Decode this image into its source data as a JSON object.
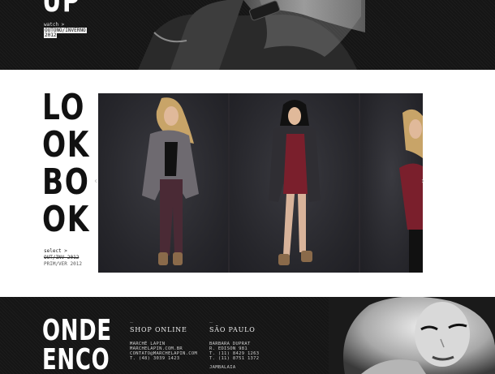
{
  "top": {
    "heading": "UP",
    "watch_label": "watch >",
    "season": "OUTONO/INVERNO",
    "year": "2012"
  },
  "lookbook": {
    "title_lines": [
      "LO",
      "OK",
      "BO",
      "OK"
    ],
    "select_label": "select >",
    "option_active": "OUT/INV 2012",
    "option_other": "PRIM/VER 2012",
    "prev_arrow": "‹",
    "next_arrow": "›"
  },
  "footer": {
    "title_lines": [
      "ONDE",
      "ENCO"
    ],
    "dash": "_",
    "shop": {
      "heading": "SHOP ONLINE",
      "lines": [
        "MARCHÉ LAPIN",
        "MARCHELAPIN.COM.BR",
        "CONTATO@MARCHELAPIN.COM",
        "T. (48) 3039 1423"
      ]
    },
    "sao_paulo": {
      "heading": "SÃO PAULO",
      "lines": [
        "BARBARA DUPRAT",
        "R. EDISON 981",
        "T. (11) 8429 1263",
        "T. (11) 8751 1372"
      ],
      "extra": "JAMBALAIA"
    }
  },
  "colors": {
    "dark_bg": "#151515",
    "light_bg": "#ffffff",
    "photo_bg": "#2a282d"
  }
}
